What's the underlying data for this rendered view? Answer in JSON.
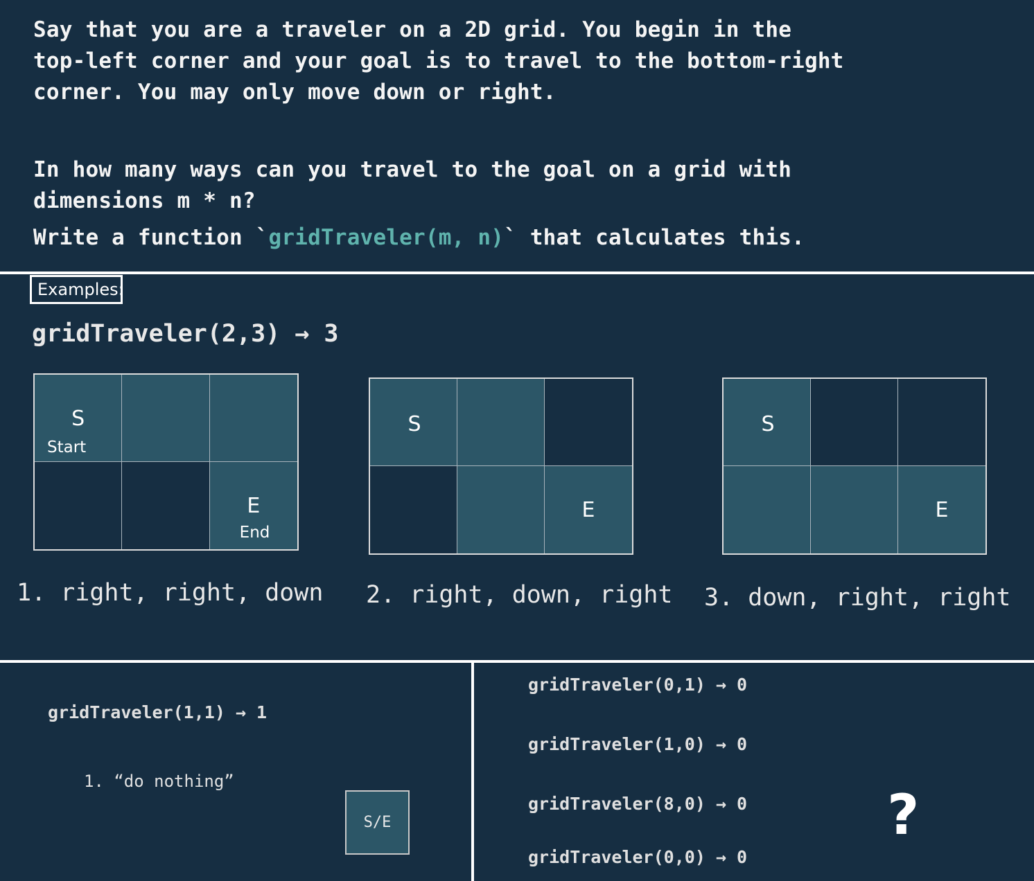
{
  "problem": {
    "line1": "Say that you are a traveler on a 2D grid. You begin in the",
    "line2": "top-left corner and your goal is to travel to the bottom-right",
    "line3": "corner. You may only move down or right.",
    "line4": "In how many ways can you travel to the goal on a grid with",
    "line5": "dimensions m * n?",
    "line6_before": "Write a function `",
    "line6_code": "gridTraveler(m, n)",
    "line6_after": "` that calculates this."
  },
  "examples": {
    "label": "Examples:",
    "heading": "gridTraveler(2,3) → 3",
    "grid1": {
      "start": "S",
      "start_label": "Start",
      "end": "E",
      "end_label": "End"
    },
    "grid2": {
      "start": "S",
      "end": "E"
    },
    "grid3": {
      "start": "S",
      "end": "E"
    },
    "path1": "1. right, right, down",
    "path2": "2. right, down, right",
    "path3": "3. down, right, right"
  },
  "bottom_left": {
    "call": "gridTraveler(1,1) → 1",
    "path": "1. “do nothing”",
    "cell": "S/E"
  },
  "bottom_right": {
    "call1": "gridTraveler(0,1) → 0",
    "call2": "gridTraveler(1,0) → 0",
    "call3": "gridTraveler(8,0) → 0",
    "call4": "gridTraveler(0,0) → 0",
    "mark": "?"
  },
  "colors": {
    "background": "#162e42",
    "path_cell": "#2c5667",
    "code_accent": "#5fb3ad"
  }
}
